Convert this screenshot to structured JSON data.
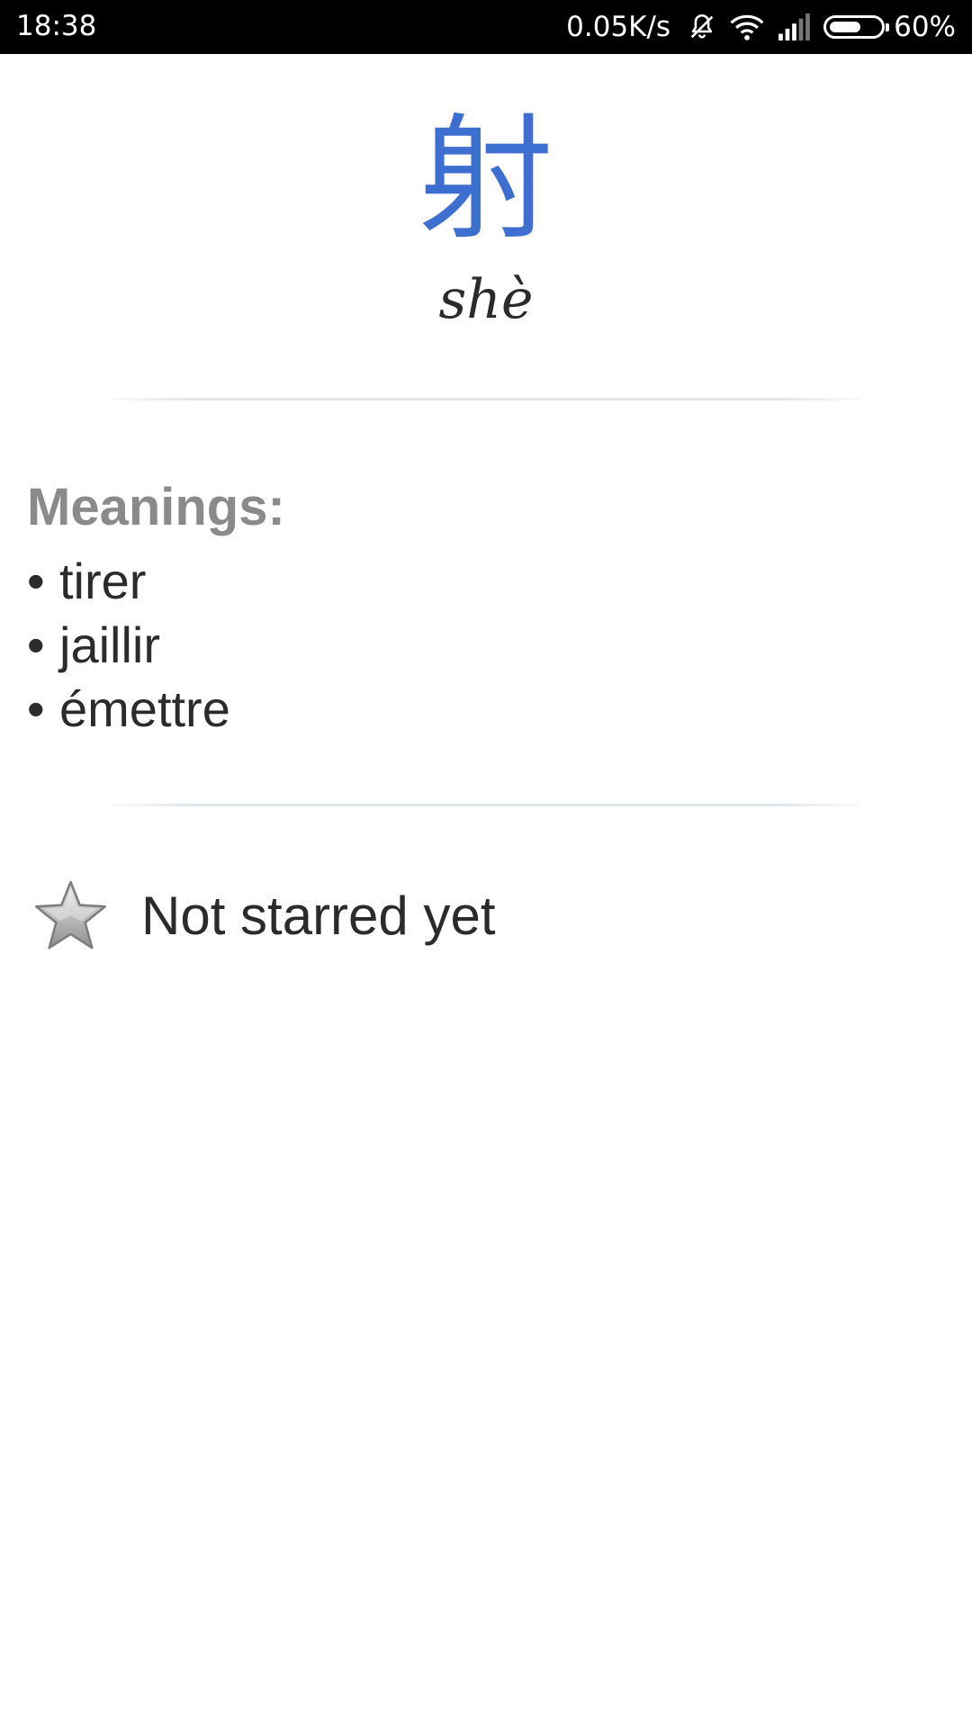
{
  "status_bar": {
    "time": "18:38",
    "network_speed": "0.05K/s",
    "battery_percent": "60%",
    "battery_level": 0.6,
    "icons": [
      "bell-muted-icon",
      "wifi-icon",
      "cell-signal-icon",
      "battery-icon"
    ]
  },
  "entry": {
    "character": "射",
    "pinyin": "shè"
  },
  "meanings": {
    "title": "Meanings:",
    "bullet": "•",
    "items": [
      "tirer",
      "jaillir",
      "émettre"
    ]
  },
  "star": {
    "icon": "star-icon",
    "label": "Not starred yet"
  },
  "colors": {
    "character": "#3d6fd1",
    "meanings_title": "#8a8a8a",
    "text": "#2b2b2b",
    "status_bar_bg": "#000000"
  }
}
